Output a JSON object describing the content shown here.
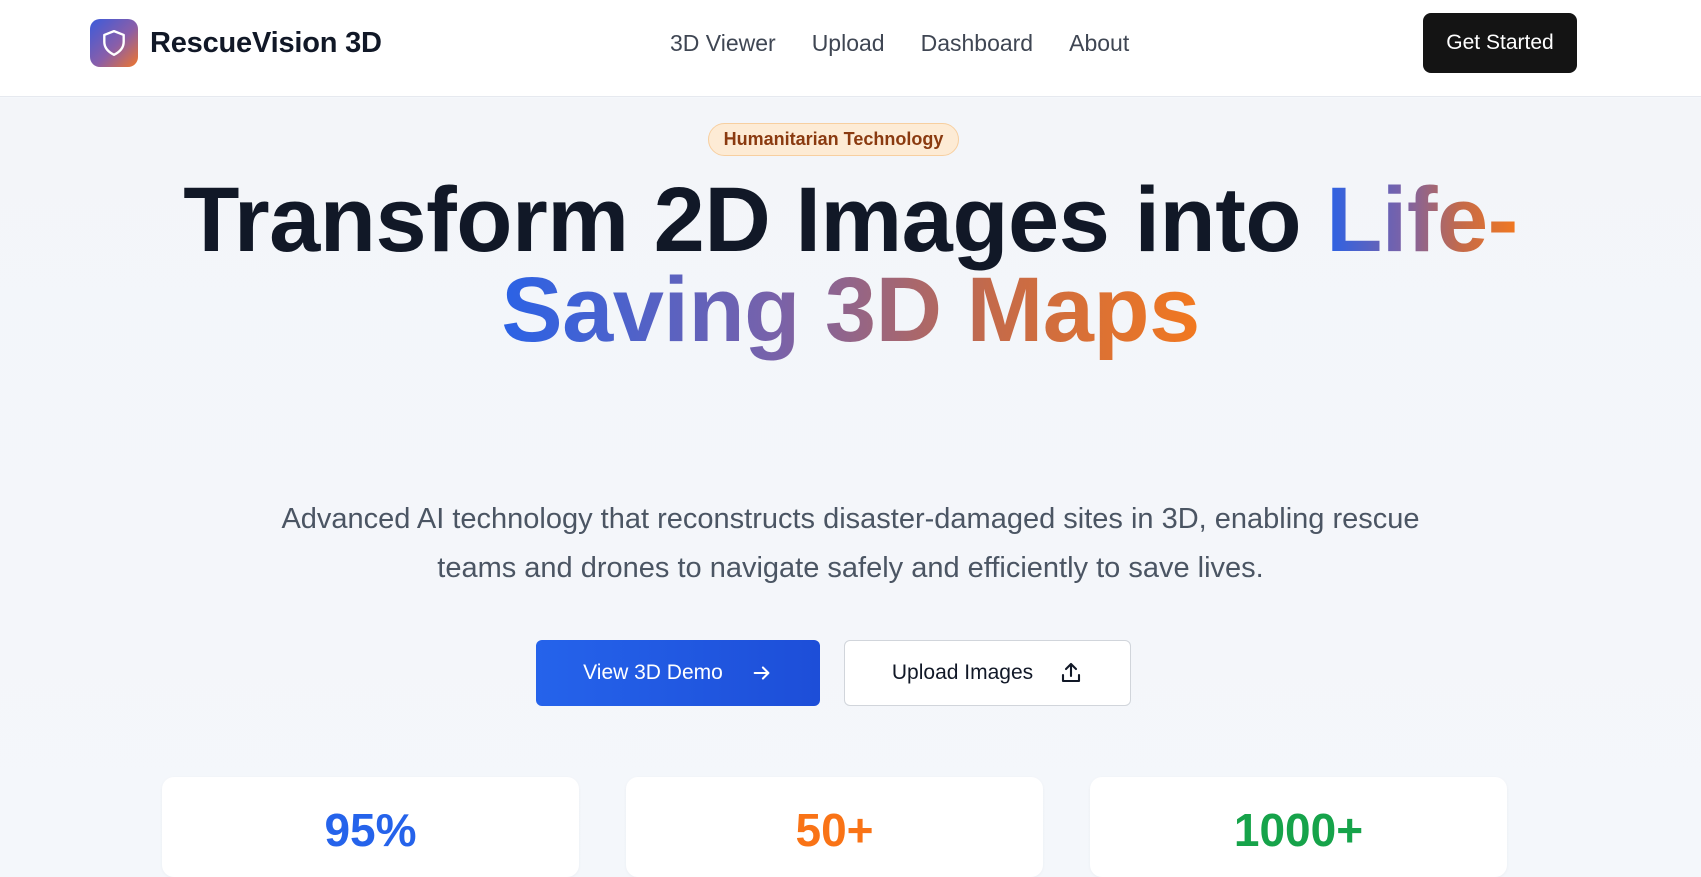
{
  "header": {
    "brand_name": "RescueVision 3D",
    "logo_icon": "shield-icon",
    "nav": [
      {
        "label": "3D Viewer"
      },
      {
        "label": "Upload"
      },
      {
        "label": "Dashboard"
      },
      {
        "label": "About"
      }
    ],
    "cta_label": "Get Started"
  },
  "hero": {
    "badge": "Humanitarian Technology",
    "headline_plain": "Transform 2D Images into ",
    "headline_gradient_1": "Life-",
    "headline_gradient_2": "Saving 3D Maps",
    "subtitle": "Advanced AI technology that reconstructs disaster-damaged sites in 3D, enabling rescue teams and drones to navigate safely and efficiently to save lives.",
    "primary_button": {
      "label": "View 3D Demo",
      "icon": "arrow-right-icon"
    },
    "secondary_button": {
      "label": "Upload Images",
      "icon": "upload-icon"
    }
  },
  "stats": [
    {
      "value": "95%",
      "color": "#2563eb"
    },
    {
      "value": "50+",
      "color": "#f97316"
    },
    {
      "value": "1000+",
      "color": "#16a34a"
    }
  ],
  "colors": {
    "accent_blue": "#2563eb",
    "accent_orange": "#f97316",
    "accent_green": "#16a34a",
    "dark": "#141414"
  }
}
